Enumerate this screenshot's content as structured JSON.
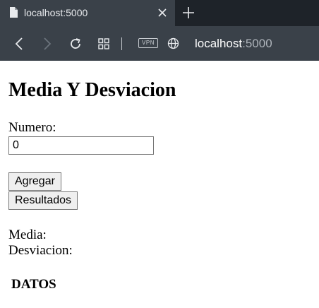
{
  "browser": {
    "tab": {
      "title": "localhost:5000"
    },
    "address_bar": {
      "host": "localhost",
      "port": ":5000"
    },
    "vpn_label": "VPN"
  },
  "page": {
    "title": "Media Y Desviacion",
    "numero": {
      "label": "Numero:",
      "value": "0"
    },
    "buttons": {
      "agregar": "Agregar",
      "resultados": "Resultados"
    },
    "results": {
      "media_label": "Media:",
      "desviacion_label": "Desviacion:"
    },
    "datos_heading": "DATOS"
  }
}
